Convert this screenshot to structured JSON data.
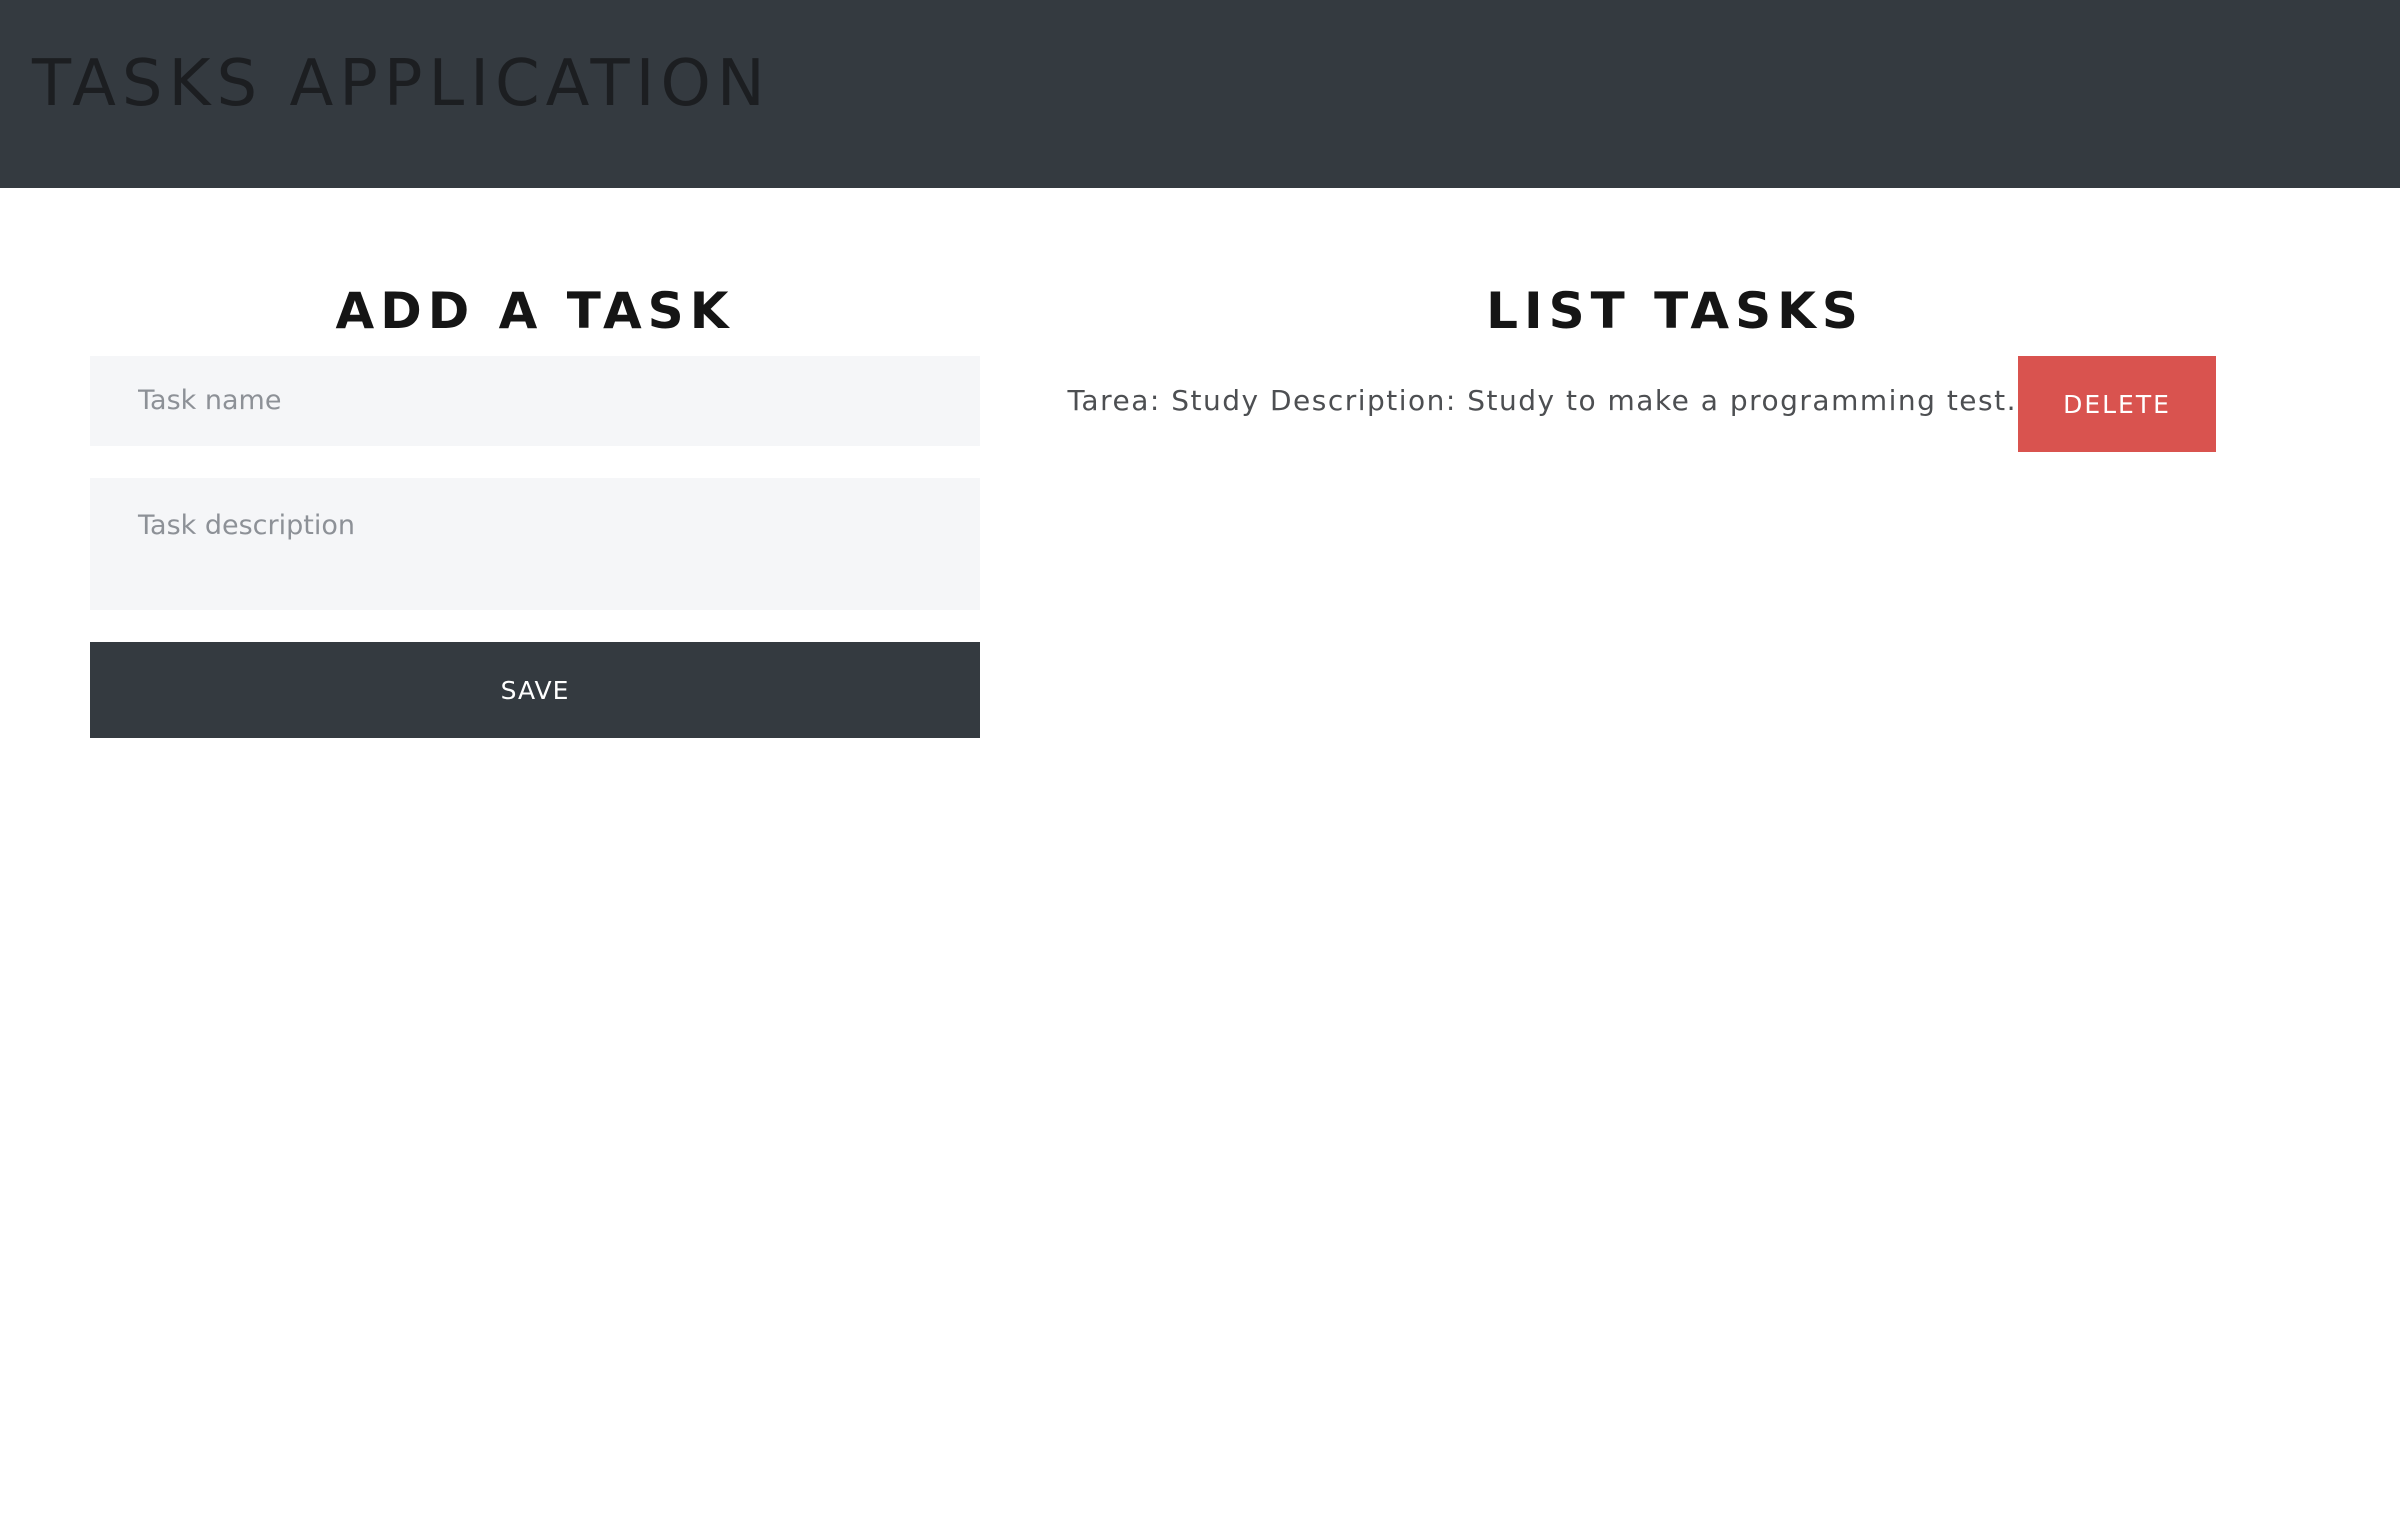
{
  "header": {
    "title": "TASKS APPLICATION"
  },
  "add_task": {
    "title": "ADD A TASK",
    "name_placeholder": "Task name",
    "description_placeholder": "Task description",
    "save_label": "SAVE"
  },
  "list_tasks": {
    "title": "LIST TASKS",
    "items": [
      {
        "text": "Tarea: Study Description: Study to make a programming test.",
        "delete_label": "DELETE"
      }
    ]
  },
  "colors": {
    "navbar": "#343a40",
    "input_bg": "#f5f6f8",
    "save_button": "#343a40",
    "delete_button": "#d9534f"
  }
}
